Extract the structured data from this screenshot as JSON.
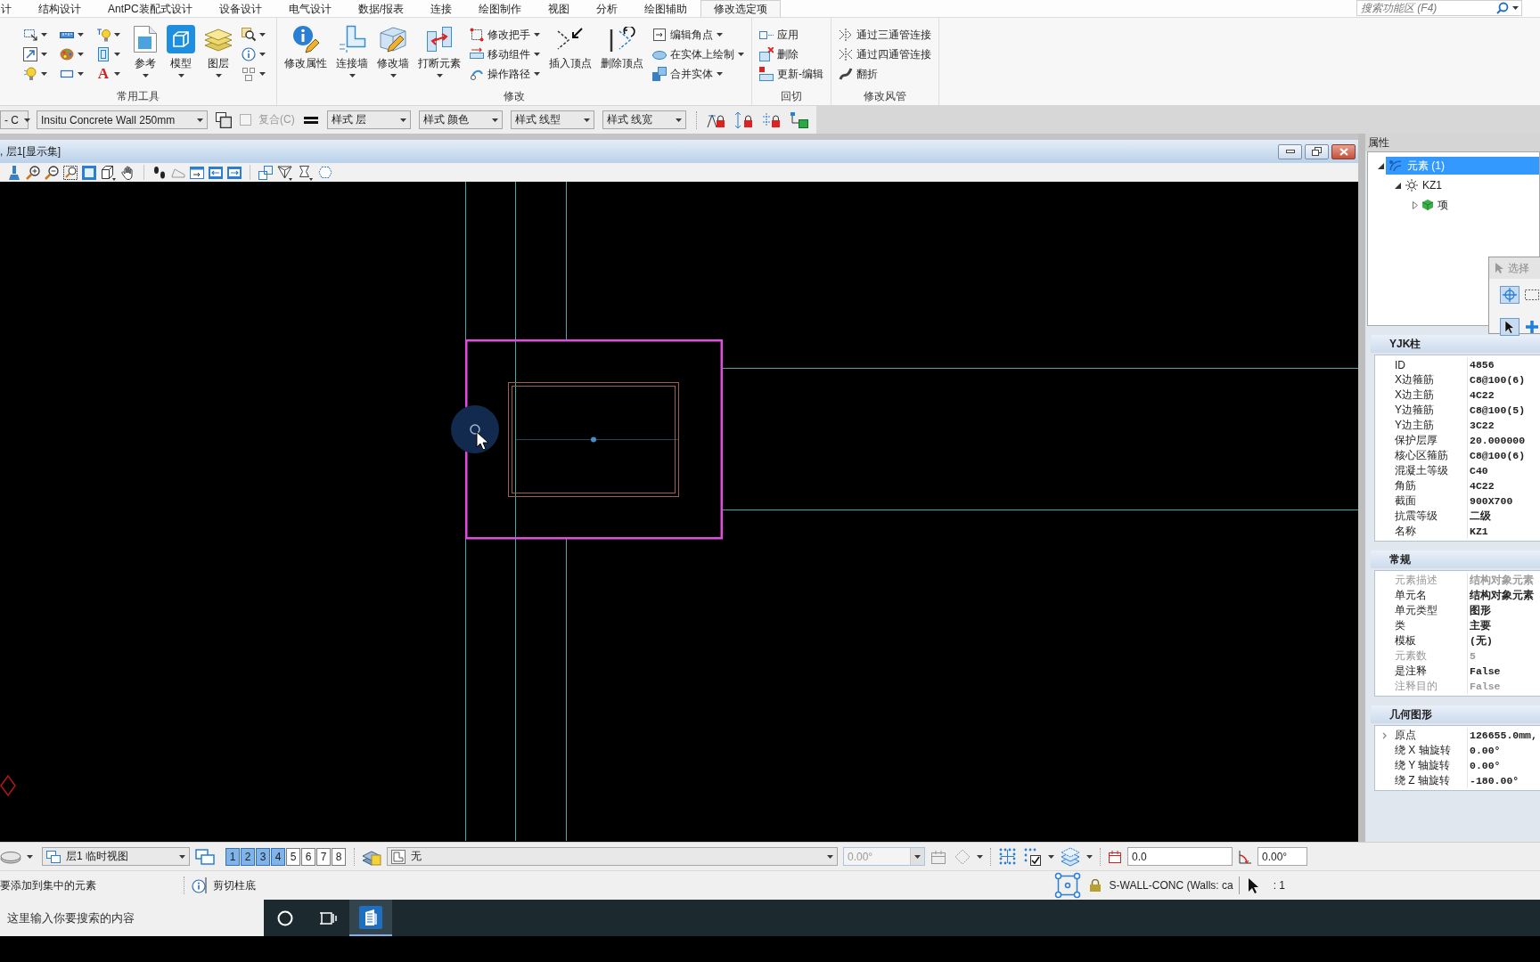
{
  "ribbon_tabs": [
    {
      "label": "计",
      "selected": false
    },
    {
      "label": "结构设计",
      "selected": false
    },
    {
      "label": "AntPC装配式设计",
      "selected": false
    },
    {
      "label": "设备设计",
      "selected": false
    },
    {
      "label": "电气设计",
      "selected": false
    },
    {
      "label": "数据/报表",
      "selected": false
    },
    {
      "label": "连接",
      "selected": false
    },
    {
      "label": "绘图制作",
      "selected": false
    },
    {
      "label": "视图",
      "selected": false
    },
    {
      "label": "分析",
      "selected": false
    },
    {
      "label": "绘图辅助",
      "selected": false
    },
    {
      "label": "修改选定项",
      "selected": true
    }
  ],
  "ribbon_search": {
    "placeholder": "搜索功能区 (F4)"
  },
  "ribbon_groups": [
    {
      "label": "常用工具",
      "columns": [
        {
          "kind": "stack",
          "items": [
            {
              "dropdown": true
            },
            {
              "dropdown": true
            },
            {
              "dropdown": true
            }
          ]
        },
        {
          "kind": "stack",
          "items": [
            {
              "dropdown": true
            },
            {
              "dropdown": true
            },
            {
              "dropdown": true
            }
          ]
        },
        {
          "kind": "stack",
          "items": [
            {
              "dropdown": true
            },
            {
              "dropdown": true
            },
            {
              "glyph": "A",
              "dropdown": true
            }
          ]
        },
        {
          "kind": "large",
          "label": "参考",
          "dropdown": true
        },
        {
          "kind": "large",
          "label": "模型",
          "dropdown": true
        },
        {
          "kind": "large",
          "label": "图层",
          "dropdown": true
        },
        {
          "kind": "stack",
          "items": [
            {
              "dropdown": true
            },
            {
              "dropdown": true
            },
            {
              "dropdown": true
            }
          ]
        }
      ]
    },
    {
      "label": "修改",
      "columns": [
        {
          "kind": "large",
          "label": "修改属性",
          "dropdown": false
        },
        {
          "kind": "large",
          "label": "连接墙",
          "dropdown": true
        },
        {
          "kind": "large",
          "label": "修改墙",
          "dropdown": true
        },
        {
          "kind": "large",
          "label": "打断元素",
          "dropdown": true
        },
        {
          "kind": "stack",
          "items": [
            {
              "label": "修改把手",
              "dropdown": true
            },
            {
              "label": "移动组件",
              "dropdown": true
            },
            {
              "label": "操作路径",
              "dropdown": true
            }
          ]
        },
        {
          "kind": "large",
          "label": "插入顶点",
          "dropdown": false
        },
        {
          "kind": "large",
          "label": "删除顶点",
          "dropdown": false
        },
        {
          "kind": "stack",
          "items": [
            {
              "label": "编辑角点",
              "dropdown": true
            },
            {
              "label": "在实体上绘制",
              "dropdown": true
            },
            {
              "label": "合并实体",
              "dropdown": true
            }
          ]
        }
      ]
    },
    {
      "label": "回切",
      "columns": [
        {
          "kind": "stack",
          "items": [
            {
              "label": "应用",
              "dropdown": false
            },
            {
              "label": "删除",
              "dropdown": false
            },
            {
              "label": "更新-编辑",
              "dropdown": false
            }
          ]
        }
      ]
    },
    {
      "label": "修改风管",
      "columns": [
        {
          "kind": "stack",
          "items": [
            {
              "label": "通过三通管连接",
              "dropdown": false
            },
            {
              "label": "通过四通管连接",
              "dropdown": false
            },
            {
              "label": "翻折",
              "dropdown": false
            }
          ]
        }
      ]
    }
  ],
  "attribute_toolbar": [
    {
      "kind": "dropdown",
      "value": "- C"
    },
    {
      "kind": "dropdown",
      "value": "Insitu Concrete Wall 250mm"
    },
    {
      "kind": "tool"
    },
    {
      "kind": "checkbox",
      "label": "复合(C)",
      "checked": false,
      "disabled": true
    },
    {
      "kind": "tool"
    },
    {
      "kind": "dropdown",
      "value": "样式 层"
    },
    {
      "kind": "dropdown",
      "value": "样式 颜色"
    },
    {
      "kind": "dropdown",
      "value": "样式 线型"
    },
    {
      "kind": "dropdown",
      "value": "样式 线宽"
    },
    {
      "kind": "separator"
    },
    {
      "kind": "tool"
    },
    {
      "kind": "tool"
    },
    {
      "kind": "tool"
    },
    {
      "kind": "tool"
    }
  ],
  "view_window": {
    "title": ", 层1[显示集]"
  },
  "properties": {
    "title": "属性",
    "tree": [
      {
        "label": "元素 (1)",
        "selected": true,
        "expanded": true,
        "children": [
          {
            "label": "KZ1",
            "selected": false,
            "expanded": true,
            "children": [
              {
                "label": "项",
                "selected": false,
                "expanded": false
              }
            ]
          }
        ]
      }
    ],
    "dialog": {
      "title": "选择",
      "tools": [
        {
          "selected": true
        },
        {
          "selected": false
        },
        {
          "selected": true
        },
        {
          "selected": false
        }
      ]
    },
    "sections": [
      {
        "title": "YJK柱",
        "rows": [
          {
            "label": "ID",
            "value": "4856",
            "disabled": false
          },
          {
            "label": "X边箍筋",
            "value": "C8@100(6)",
            "disabled": false
          },
          {
            "label": "X边主筋",
            "value": "4C22",
            "disabled": false
          },
          {
            "label": "Y边箍筋",
            "value": "C8@100(5)",
            "disabled": false
          },
          {
            "label": "Y边主筋",
            "value": "3C22",
            "disabled": false
          },
          {
            "label": "保护层厚",
            "value": "20.000000",
            "disabled": false
          },
          {
            "label": "核心区箍筋",
            "value": "C8@100(6)",
            "disabled": false
          },
          {
            "label": "混凝土等级",
            "value": "C40",
            "disabled": false
          },
          {
            "label": "角筋",
            "value": "4C22",
            "disabled": false
          },
          {
            "label": "截面",
            "value": "900X700",
            "disabled": false
          },
          {
            "label": "抗震等级",
            "value": "二级",
            "disabled": false
          },
          {
            "label": "名称",
            "value": "KZ1",
            "disabled": false
          }
        ]
      },
      {
        "title": "常规",
        "rows": [
          {
            "label": "元素描述",
            "value": "结构对象元素",
            "disabled": true
          },
          {
            "label": "单元名",
            "value": "结构对象元素",
            "disabled": false
          },
          {
            "label": "单元类型",
            "value": "图形",
            "disabled": false
          },
          {
            "label": "类",
            "value": "主要",
            "disabled": false
          },
          {
            "label": "模板",
            "value": "(无)",
            "disabled": false
          },
          {
            "label": "元素数",
            "value": "5",
            "disabled": true
          },
          {
            "label": "是注释",
            "value": "False",
            "disabled": false
          },
          {
            "label": "注释目的",
            "value": "False",
            "disabled": true
          }
        ]
      },
      {
        "title": "几何图形",
        "rows": [
          {
            "label": "原点",
            "value": "126655.0mm,",
            "disabled": false,
            "expanded": false
          },
          {
            "label": "绕 X 轴旋转",
            "value": "0.00°",
            "disabled": false
          },
          {
            "label": "绕 Y 轴旋转",
            "value": "0.00°",
            "disabled": false
          },
          {
            "label": "绕 Z 轴旋转",
            "value": "-180.00°",
            "disabled": false
          }
        ]
      }
    ]
  },
  "view_bar": {
    "view_selector": "层1 临时视图",
    "views": [
      {
        "label": "1",
        "selected": true
      },
      {
        "label": "2",
        "selected": true
      },
      {
        "label": "3",
        "selected": true
      },
      {
        "label": "4",
        "selected": true
      },
      {
        "label": "5",
        "selected": false
      },
      {
        "label": "6",
        "selected": false
      },
      {
        "label": "7",
        "selected": false
      },
      {
        "label": "8",
        "selected": false
      }
    ],
    "level_selector": "无",
    "angle": {
      "value": "0.00°",
      "disabled": true
    },
    "elevation": "0.0",
    "rotation": "0.00°"
  },
  "status_bar": {
    "prompt": "要添加到集中的元素",
    "command": "剪切柱底",
    "active_level": "S-WALL-CONC (Walls: ca",
    "selection_count": ": 1"
  },
  "taskbar": {
    "search": {
      "placeholder": "这里输入你要搜索的内容"
    },
    "apps": [
      {
        "active": true
      }
    ]
  }
}
